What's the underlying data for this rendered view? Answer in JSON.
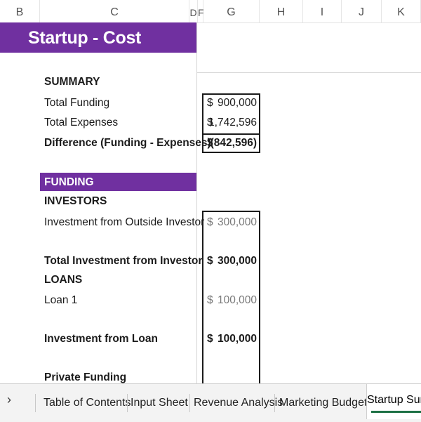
{
  "column_headers": [
    "B",
    "C",
    "D",
    "F",
    "G",
    "H",
    "I",
    "J",
    "K"
  ],
  "title": "Startup - Cost Analysis",
  "summary": {
    "heading": "SUMMARY",
    "rows": [
      {
        "label": "Total Funding",
        "currency": "$",
        "amount": "900,000"
      },
      {
        "label": "Total Expenses",
        "currency": "$",
        "amount": "1,742,596"
      },
      {
        "label": "Difference (Funding - Expenses)",
        "currency": "$",
        "amount": "(842,596)"
      }
    ]
  },
  "funding": {
    "band": "FUNDING",
    "investors_heading": "INVESTORS",
    "outside_investor_label": "Investment from Outside Investor",
    "outside_investor_currency": "$",
    "outside_investor_amount": "300,000",
    "total_investor_label": "Total Investment from Investor",
    "total_investor_currency": "$",
    "total_investor_amount": "300,000",
    "loans_heading": "LOANS",
    "loan1_label": "Loan 1",
    "loan1_currency": "$",
    "loan1_amount": "100,000",
    "loan_total_label": "Investment from Loan",
    "loan_total_currency": "$",
    "loan_total_amount": "100,000",
    "private_heading": "Private Funding"
  },
  "tabs": {
    "nav_icon": "chevron-right-icon",
    "nav_glyph": "›",
    "items": [
      "Table of Contents",
      "Input Sheet",
      "Revenue Analysis",
      "Marketing Budget",
      "Startup Sum"
    ],
    "active_index": 4
  },
  "colors": {
    "accent_purple": "#7030a0",
    "active_tab_underline": "#1e7145"
  }
}
